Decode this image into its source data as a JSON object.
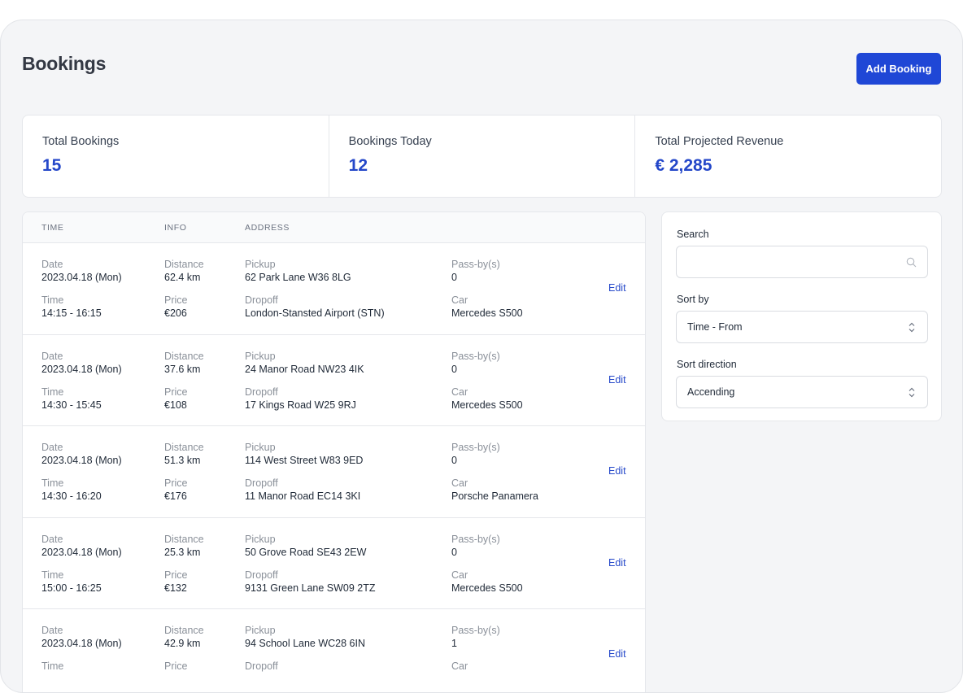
{
  "header": {
    "title": "Bookings",
    "add_button": "Add Booking"
  },
  "stats": [
    {
      "label": "Total Bookings",
      "value": "15"
    },
    {
      "label": "Bookings Today",
      "value": "12"
    },
    {
      "label": "Total Projected Revenue",
      "value": "€ 2,285"
    }
  ],
  "table": {
    "headers": {
      "time": "TIME",
      "info": "INFO",
      "address": "ADDRESS"
    },
    "labels": {
      "date": "Date",
      "time": "Time",
      "distance": "Distance",
      "price": "Price",
      "pickup": "Pickup",
      "dropoff": "Dropoff",
      "passby": "Pass-by(s)",
      "car": "Car",
      "edit": "Edit"
    },
    "rows": [
      {
        "date": "2023.04.18 (Mon)",
        "time": "14:15 - 16:15",
        "distance": "62.4 km",
        "price": "€206",
        "pickup": "62 Park Lane W36 8LG",
        "dropoff": "London-Stansted Airport (STN)",
        "passby": "0",
        "car": "Mercedes S500"
      },
      {
        "date": "2023.04.18 (Mon)",
        "time": "14:30 - 15:45",
        "distance": "37.6 km",
        "price": "€108",
        "pickup": "24 Manor Road NW23 4IK",
        "dropoff": "17 Kings Road W25 9RJ",
        "passby": "0",
        "car": "Mercedes S500"
      },
      {
        "date": "2023.04.18 (Mon)",
        "time": "14:30 - 16:20",
        "distance": "51.3 km",
        "price": "€176",
        "pickup": "114 West Street W83 9ED",
        "dropoff": "11 Manor Road EC14 3KI",
        "passby": "0",
        "car": "Porsche Panamera"
      },
      {
        "date": "2023.04.18 (Mon)",
        "time": "15:00 - 16:25",
        "distance": "25.3 km",
        "price": "€132",
        "pickup": "50 Grove Road SE43 2EW",
        "dropoff": "9131 Green Lane SW09 2TZ",
        "passby": "0",
        "car": "Mercedes S500"
      },
      {
        "date": "2023.04.18 (Mon)",
        "time": "",
        "distance": "42.9 km",
        "price": "",
        "pickup": "94 School Lane WC28 6IN",
        "dropoff": "",
        "passby": "1",
        "car": ""
      }
    ]
  },
  "filters": {
    "search_label": "Search",
    "search_value": "",
    "sort_by_label": "Sort by",
    "sort_by_value": "Time - From",
    "sort_direction_label": "Sort direction",
    "sort_direction_value": "Accending"
  },
  "icons": {
    "search": "search-icon",
    "select": "chevron-up-down-icon"
  },
  "colors": {
    "accent": "#1f47d6",
    "stat_value": "#2447c9",
    "background": "#f4f5f7"
  }
}
